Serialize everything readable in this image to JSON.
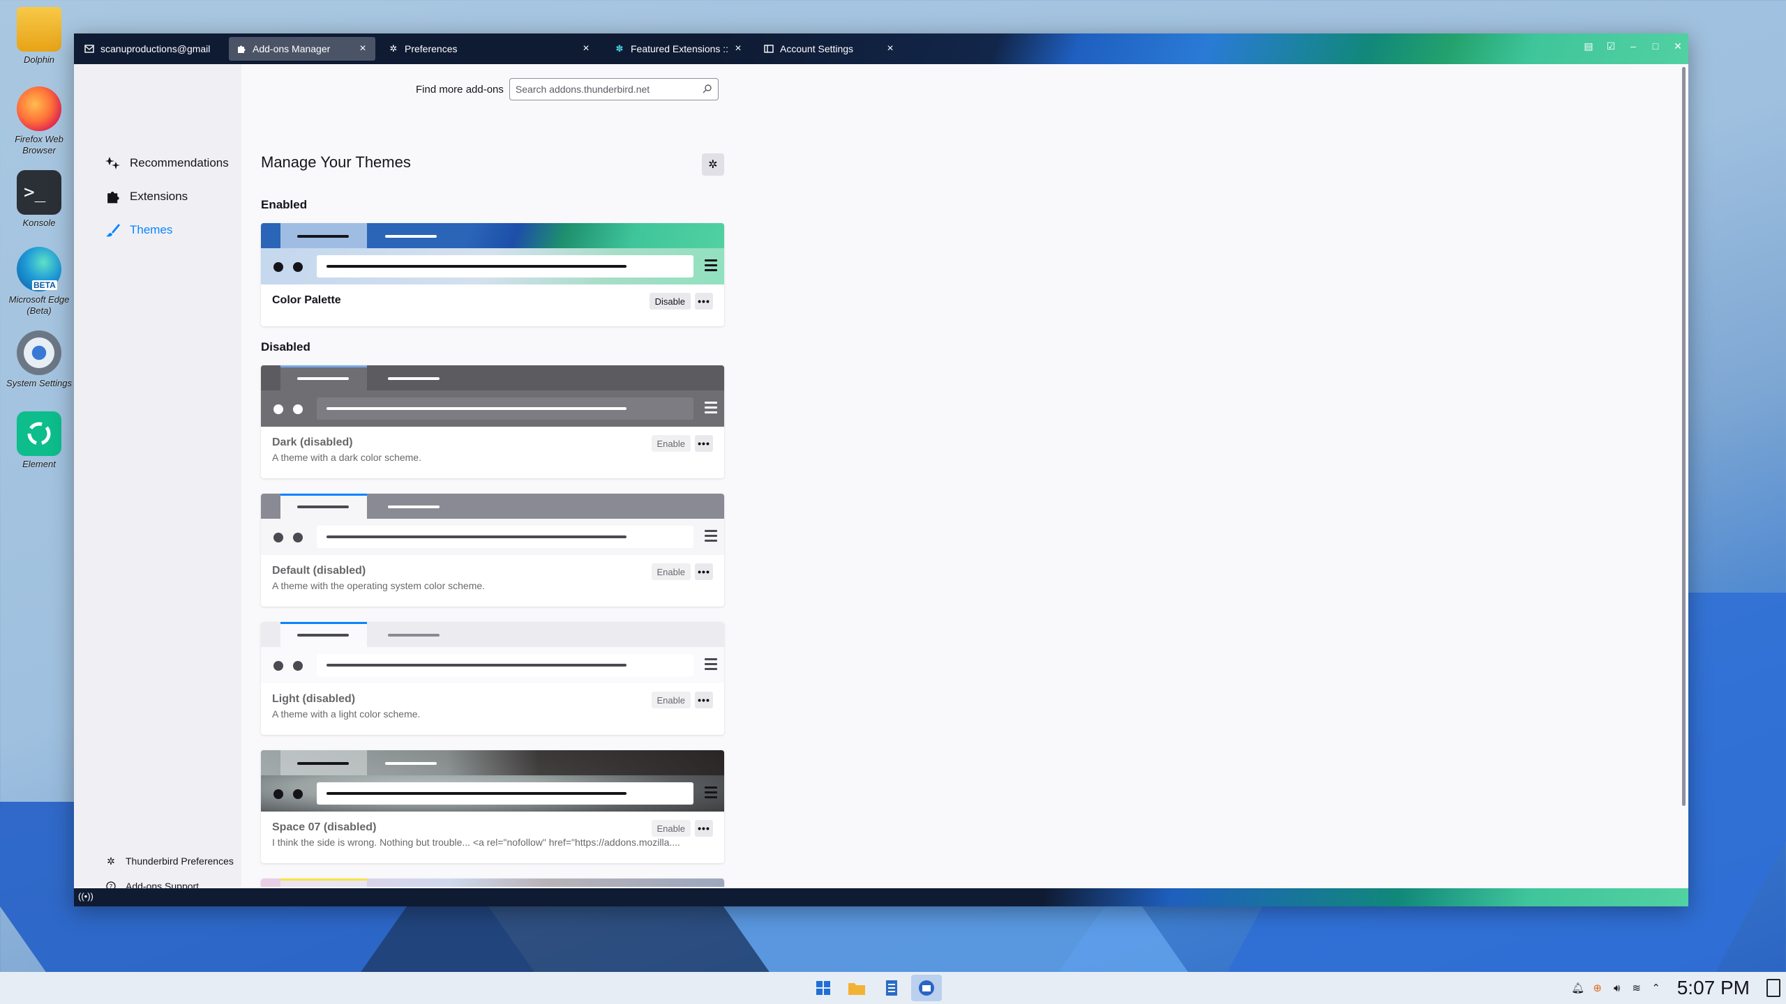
{
  "desktop": {
    "icons": [
      {
        "label": "Dolphin",
        "icon": "folder-icon"
      },
      {
        "label": "Firefox Web Browser",
        "icon": "firefox-icon"
      },
      {
        "label": "Konsole",
        "icon": "terminal-icon"
      },
      {
        "label": "Microsoft Edge (Beta)",
        "icon": "edge-beta-icon",
        "badge": "BETA"
      },
      {
        "label": "System Settings",
        "icon": "settings-icon"
      },
      {
        "label": "Element",
        "icon": "element-icon"
      }
    ]
  },
  "window": {
    "tabs": [
      {
        "label": "scanuproductions@gmail.c",
        "icon": "mail-icon",
        "active": false
      },
      {
        "label": "Add-ons Manager",
        "icon": "puzzle-icon",
        "active": true
      },
      {
        "label": "Preferences",
        "icon": "gear-icon",
        "active": false
      },
      {
        "label": "Featured Extensions :: A",
        "icon": "addon-site-icon",
        "active": false
      },
      {
        "label": "Account Settings",
        "icon": "account-icon",
        "active": false
      }
    ],
    "close_glyph": "×",
    "controls": [
      "calendar-icon",
      "tasks-icon",
      "minimize-icon",
      "maximize-icon",
      "close-icon"
    ]
  },
  "sidebar": {
    "categories": [
      {
        "label": "Recommendations",
        "icon": "recommendations-icon",
        "selected": false
      },
      {
        "label": "Extensions",
        "icon": "puzzle-icon",
        "selected": false
      },
      {
        "label": "Themes",
        "icon": "brush-icon",
        "selected": true
      }
    ],
    "footer": [
      {
        "label": "Thunderbird Preferences",
        "icon": "gear-icon"
      },
      {
        "label": "Add-ons Support",
        "icon": "help-icon"
      }
    ]
  },
  "main": {
    "find_more_label": "Find more add-ons",
    "search_placeholder": "Search addons.thunderbird.net",
    "heading": "Manage Your Themes",
    "enabled_heading": "Enabled",
    "disabled_heading": "Disabled",
    "more_glyph": "•••",
    "themes_enabled": [
      {
        "name": "Color Palette",
        "description": "",
        "action": "Disable"
      }
    ],
    "themes_disabled": [
      {
        "name": "Dark (disabled)",
        "description": "A theme with a dark color scheme.",
        "action": "Enable"
      },
      {
        "name": "Default (disabled)",
        "description": "A theme with the operating system color scheme.",
        "action": "Enable"
      },
      {
        "name": "Light (disabled)",
        "description": "A theme with a light color scheme.",
        "action": "Enable"
      },
      {
        "name": "Space 07 (disabled)",
        "description": "I think the side is wrong. Nothing but trouble... <a rel=\"nofollow\" href=\"https://addons.mozilla....",
        "action": "Enable"
      }
    ]
  },
  "taskbar": {
    "apps": [
      "start-menu-icon",
      "dolphin-icon",
      "notes-icon",
      "thunderbird-icon"
    ],
    "tray": [
      "notifications-icon",
      "network-alert-icon",
      "volume-icon",
      "wifi-icon",
      "expand-tray-icon"
    ],
    "clock": "5:07 PM"
  },
  "colors": {
    "accent": "#0a84ff",
    "palette_blue": "#2a65b8",
    "palette_green": "#3fc59a"
  }
}
